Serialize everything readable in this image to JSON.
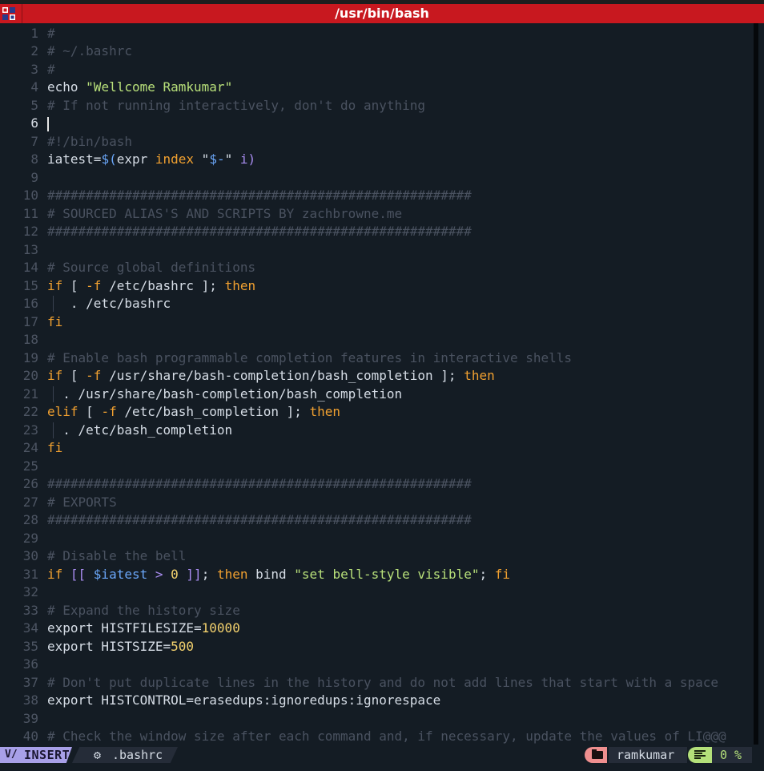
{
  "window": {
    "title": "/usr/bin/bash"
  },
  "editor": {
    "cursor_line": 6,
    "lines": [
      {
        "n": "1",
        "tokens": [
          {
            "c": "comment",
            "t": "#"
          }
        ]
      },
      {
        "n": "2",
        "tokens": [
          {
            "c": "comment",
            "t": "# ~/.bashrc"
          }
        ]
      },
      {
        "n": "3",
        "tokens": [
          {
            "c": "comment",
            "t": "#"
          }
        ]
      },
      {
        "n": "4",
        "tokens": [
          {
            "c": "def",
            "t": "echo "
          },
          {
            "c": "str",
            "t": "\"Wellcome Ramkumar\""
          }
        ]
      },
      {
        "n": "5",
        "tokens": [
          {
            "c": "comment",
            "t": "# If not running interactively, don't do anything"
          }
        ]
      },
      {
        "n": "6",
        "tokens": []
      },
      {
        "n": "7",
        "tokens": [
          {
            "c": "comment",
            "t": "#!/bin/bash"
          }
        ]
      },
      {
        "n": "8",
        "tokens": [
          {
            "c": "def",
            "t": "iatest="
          },
          {
            "c": "var",
            "t": "$("
          },
          {
            "c": "def",
            "t": "expr "
          },
          {
            "c": "kw",
            "t": "index"
          },
          {
            "c": "def",
            "t": " \""
          },
          {
            "c": "var",
            "t": "$-"
          },
          {
            "c": "def",
            "t": "\" "
          },
          {
            "c": "op",
            "t": "i)"
          }
        ]
      },
      {
        "n": "9",
        "tokens": []
      },
      {
        "n": "10",
        "tokens": [
          {
            "c": "comment",
            "t": "#######################################################"
          }
        ]
      },
      {
        "n": "11",
        "tokens": [
          {
            "c": "comment",
            "t": "# SOURCED ALIAS'S AND SCRIPTS BY zachbrowne.me"
          }
        ]
      },
      {
        "n": "12",
        "tokens": [
          {
            "c": "comment",
            "t": "#######################################################"
          }
        ]
      },
      {
        "n": "13",
        "tokens": []
      },
      {
        "n": "14",
        "tokens": [
          {
            "c": "comment",
            "t": "# Source global definitions"
          }
        ]
      },
      {
        "n": "15",
        "tokens": [
          {
            "c": "kw",
            "t": "if"
          },
          {
            "c": "def",
            "t": " [ "
          },
          {
            "c": "kw",
            "t": "-f"
          },
          {
            "c": "def",
            "t": " /etc/bashrc ]; "
          },
          {
            "c": "kw",
            "t": "then"
          }
        ]
      },
      {
        "n": "16",
        "guide": true,
        "tokens": [
          {
            "c": "def",
            "t": "   . /etc/bashrc"
          }
        ]
      },
      {
        "n": "17",
        "tokens": [
          {
            "c": "kw",
            "t": "fi"
          }
        ]
      },
      {
        "n": "18",
        "tokens": []
      },
      {
        "n": "19",
        "tokens": [
          {
            "c": "comment",
            "t": "# Enable bash programmable completion features in interactive shells"
          }
        ]
      },
      {
        "n": "20",
        "tokens": [
          {
            "c": "kw",
            "t": "if"
          },
          {
            "c": "def",
            "t": " [ "
          },
          {
            "c": "kw",
            "t": "-f"
          },
          {
            "c": "def",
            "t": " /usr/share/bash-completion/bash_completion ]; "
          },
          {
            "c": "kw",
            "t": "then"
          }
        ]
      },
      {
        "n": "21",
        "guide": true,
        "tokens": [
          {
            "c": "def",
            "t": "  . /usr/share/bash-completion/bash_completion"
          }
        ]
      },
      {
        "n": "22",
        "tokens": [
          {
            "c": "kw",
            "t": "elif"
          },
          {
            "c": "def",
            "t": " [ "
          },
          {
            "c": "kw",
            "t": "-f"
          },
          {
            "c": "def",
            "t": " /etc/bash_completion ]; "
          },
          {
            "c": "kw",
            "t": "then"
          }
        ]
      },
      {
        "n": "23",
        "guide": true,
        "tokens": [
          {
            "c": "def",
            "t": "  . /etc/bash_completion"
          }
        ]
      },
      {
        "n": "24",
        "tokens": [
          {
            "c": "kw",
            "t": "fi"
          }
        ]
      },
      {
        "n": "25",
        "tokens": []
      },
      {
        "n": "26",
        "tokens": [
          {
            "c": "comment",
            "t": "#######################################################"
          }
        ]
      },
      {
        "n": "27",
        "tokens": [
          {
            "c": "comment",
            "t": "# EXPORTS"
          }
        ]
      },
      {
        "n": "28",
        "tokens": [
          {
            "c": "comment",
            "t": "#######################################################"
          }
        ]
      },
      {
        "n": "29",
        "tokens": []
      },
      {
        "n": "30",
        "tokens": [
          {
            "c": "comment",
            "t": "# Disable the bell"
          }
        ]
      },
      {
        "n": "31",
        "tokens": [
          {
            "c": "kw",
            "t": "if"
          },
          {
            "c": "op",
            "t": " [[ "
          },
          {
            "c": "var",
            "t": "$iatest"
          },
          {
            "c": "op",
            "t": " > "
          },
          {
            "c": "num",
            "t": "0"
          },
          {
            "c": "op",
            "t": " ]]"
          },
          {
            "c": "def",
            "t": "; "
          },
          {
            "c": "kw",
            "t": "then"
          },
          {
            "c": "def",
            "t": " bind "
          },
          {
            "c": "str",
            "t": "\"set bell-style visible\""
          },
          {
            "c": "def",
            "t": "; "
          },
          {
            "c": "kw",
            "t": "fi"
          }
        ]
      },
      {
        "n": "32",
        "tokens": []
      },
      {
        "n": "33",
        "tokens": [
          {
            "c": "comment",
            "t": "# Expand the history size"
          }
        ]
      },
      {
        "n": "34",
        "tokens": [
          {
            "c": "def",
            "t": "export HISTFILESIZE="
          },
          {
            "c": "num",
            "t": "10000"
          }
        ]
      },
      {
        "n": "35",
        "tokens": [
          {
            "c": "def",
            "t": "export HISTSIZE="
          },
          {
            "c": "num",
            "t": "500"
          }
        ]
      },
      {
        "n": "36",
        "tokens": []
      },
      {
        "n": "37",
        "tokens": [
          {
            "c": "comment",
            "t": "# Don't put duplicate lines in the history and do not add lines that start with a space"
          }
        ]
      },
      {
        "n": "38",
        "tokens": [
          {
            "c": "def",
            "t": "export HISTCONTROL=erasedups:ignoredups:ignorespace"
          }
        ]
      },
      {
        "n": "39",
        "tokens": []
      },
      {
        "n": "40",
        "tokens": [
          {
            "c": "comment",
            "t": "# Check the window size after each command and, if necessary, update the values of LI@@@"
          }
        ]
      }
    ]
  },
  "statusline": {
    "mode_icon": "vim-icon",
    "mode": "INSERT",
    "file_icon": "gear-icon",
    "filename": ".bashrc",
    "user_icon": "folder-icon",
    "user": "ramkumar",
    "position_icon": "lines-icon",
    "position": "0 %"
  },
  "colors": {
    "background": "#141c24",
    "titlebar": "#c8181f",
    "comment": "#4a5260",
    "keyword": "#f0a030",
    "string": "#b8e07a",
    "variable": "#6aa6f8",
    "operator": "#a88cf0",
    "number": "#f4d26e",
    "mode_badge": "#a8a0e8",
    "user_badge": "#ef8f8f",
    "position_badge": "#b4e07a"
  }
}
